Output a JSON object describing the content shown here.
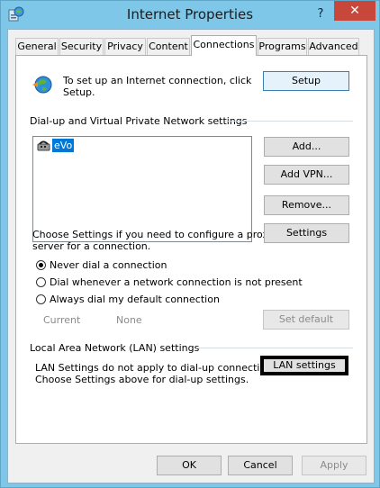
{
  "window": {
    "title": "Internet Properties",
    "help_label": "?",
    "close_label": "✕"
  },
  "tabs": [
    {
      "label": "General"
    },
    {
      "label": "Security"
    },
    {
      "label": "Privacy"
    },
    {
      "label": "Content"
    },
    {
      "label": "Connections"
    },
    {
      "label": "Programs"
    },
    {
      "label": "Advanced"
    }
  ],
  "setup": {
    "text_line1": "To set up an Internet connection, click",
    "text_line2": "Setup.",
    "button": "Setup"
  },
  "dialup": {
    "group_label": "Dial-up and Virtual Private Network settings",
    "connections": [
      "eVo"
    ],
    "add_button": "Add...",
    "add_vpn_button": "Add VPN...",
    "remove_button": "Remove...",
    "proxy_text_line1": "Choose Settings if you need to configure a proxy",
    "proxy_text_line2": "server for a connection.",
    "settings_button": "Settings",
    "radio_never": "Never dial a connection",
    "radio_whenever": "Dial whenever a network connection is not present",
    "radio_always": "Always dial my default connection",
    "selected_radio": "never",
    "current_label": "Current",
    "current_value": "None",
    "set_default_button": "Set default"
  },
  "lan": {
    "group_label": "Local Area Network (LAN) settings",
    "text_line1": "LAN Settings do not apply to dial-up connections.",
    "text_line2": "Choose Settings above for dial-up settings.",
    "button": "LAN settings"
  },
  "footer": {
    "ok": "OK",
    "cancel": "Cancel",
    "apply": "Apply"
  },
  "colors": {
    "frame": "#7ec7e8",
    "close": "#c7473b",
    "selection": "#0078d7"
  }
}
